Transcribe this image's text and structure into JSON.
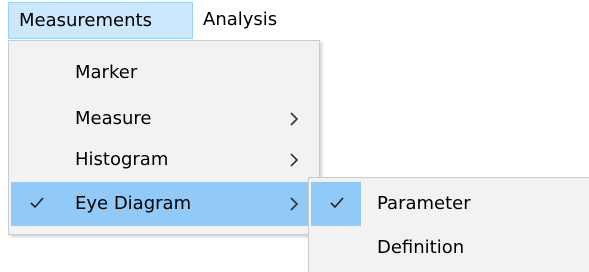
{
  "menubar": {
    "items": [
      {
        "label": "Measurements"
      },
      {
        "label": "Analysis"
      }
    ]
  },
  "measurements_menu": {
    "items": [
      {
        "label": "Marker",
        "checked": false,
        "has_submenu": false
      },
      {
        "label": "Measure",
        "checked": false,
        "has_submenu": true
      },
      {
        "label": "Histogram",
        "checked": false,
        "has_submenu": true
      },
      {
        "label": "Eye Diagram",
        "checked": true,
        "has_submenu": true
      }
    ]
  },
  "eye_diagram_submenu": {
    "items": [
      {
        "label": "Parameter",
        "checked": true
      },
      {
        "label": "Definition",
        "checked": false
      }
    ]
  },
  "colors": {
    "menubar_open_bg": "#cce8ff",
    "highlight_bg": "#91c9f7",
    "menu_bg": "#f2f2f2"
  },
  "icons": {
    "check": "check-icon",
    "submenu": "chevron-right-icon"
  }
}
